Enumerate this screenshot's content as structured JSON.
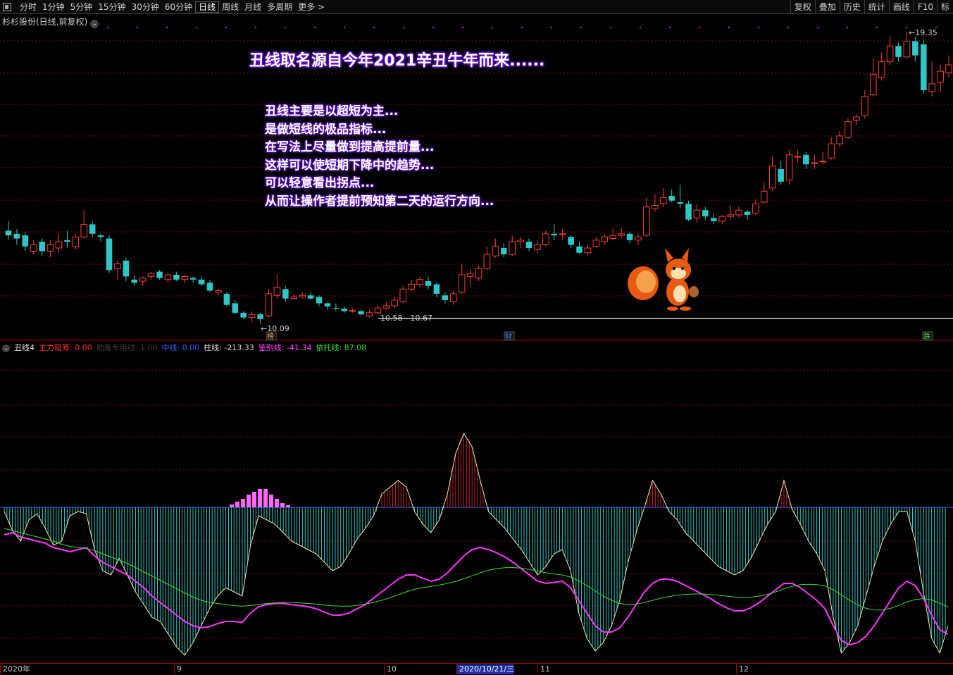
{
  "toolbar": {
    "tabs": [
      "分时",
      "1分钟",
      "5分钟",
      "15分钟",
      "30分钟",
      "60分钟",
      "日线",
      "周线",
      "月线",
      "多周期",
      "更多 >"
    ],
    "active_tab": "日线",
    "right_tools": [
      "复权",
      "叠加",
      "历史",
      "统计",
      "画线",
      "F10",
      "标"
    ]
  },
  "stock": {
    "name": "杉杉股份(日线,前复权)"
  },
  "annotations": {
    "title": "丑线取名源自今年2021辛丑牛年而来......",
    "notes": [
      "丑线主要是以超短为主...",
      "是做短线的极品指标...",
      "在写法上尽量做到提高提前量...",
      "这样可以使短期下降中的趋势...",
      "可以轻意看出拐点...",
      "从而让操作者提前预知第二天的运行方向..."
    ],
    "high_label": "19.35",
    "low_label": "10.09",
    "range_label": "10.58 - 10.67",
    "markers": [
      "榜",
      "财",
      "跌"
    ]
  },
  "indicator": {
    "name": "丑线4",
    "items": [
      {
        "label": "主力吸筹: 0.00",
        "color": "#ff3030"
      },
      {
        "label": "助筹专用线: 1.00",
        "color": "#3a3a3a"
      },
      {
        "label": "中线: 0.00",
        "color": "#3a5cff"
      },
      {
        "label": "柱线: -213.33",
        "color": "#d8d8d8"
      },
      {
        "label": "鉴别线: -41.34",
        "color": "#ff44ff"
      },
      {
        "label": "依托线: 87.08",
        "color": "#33dd33"
      }
    ]
  },
  "dates": [
    {
      "label": "2020年",
      "selected": false
    },
    {
      "label": "9",
      "selected": false
    },
    {
      "label": "10",
      "selected": false
    },
    {
      "label": "2020/10/21/三",
      "selected": true
    },
    {
      "label": "11",
      "selected": false
    },
    {
      "label": "12",
      "selected": false
    }
  ],
  "colors": {
    "up": "#ff3c3c",
    "down": "#2fc6c6",
    "bg": "#000000",
    "grid": "#7a1010"
  },
  "chart_data": [
    {
      "type": "candlestick",
      "title": "杉杉股份(日线,前复权)",
      "price_range": [
        10.09,
        19.35
      ],
      "high": 19.35,
      "low": 10.09,
      "support_range": [
        10.58,
        10.67
      ],
      "candles": [
        [
          13.05,
          12.9,
          13.35,
          12.75
        ],
        [
          12.95,
          12.8,
          13.1,
          12.6
        ],
        [
          12.9,
          12.55,
          13.0,
          12.4
        ],
        [
          12.4,
          12.6,
          12.75,
          12.3
        ],
        [
          12.7,
          12.4,
          12.8,
          12.25
        ],
        [
          12.4,
          12.6,
          12.75,
          12.2
        ],
        [
          12.5,
          12.7,
          12.95,
          12.35
        ],
        [
          12.75,
          12.7,
          13.05,
          12.5
        ],
        [
          12.55,
          12.85,
          12.95,
          12.45
        ],
        [
          12.85,
          13.25,
          13.7,
          12.8
        ],
        [
          13.25,
          12.95,
          13.35,
          12.85
        ],
        [
          12.9,
          12.85,
          12.95,
          12.7
        ],
        [
          12.8,
          11.8,
          12.9,
          11.7
        ],
        [
          11.85,
          12.0,
          12.1,
          11.5
        ],
        [
          12.1,
          11.6,
          12.2,
          11.45
        ],
        [
          11.5,
          11.4,
          11.65,
          11.3
        ],
        [
          11.45,
          11.55,
          11.6,
          11.3
        ],
        [
          11.6,
          11.7,
          11.75,
          11.5
        ],
        [
          11.75,
          11.55,
          11.8,
          11.5
        ],
        [
          11.5,
          11.65,
          11.7,
          11.4
        ],
        [
          11.65,
          11.5,
          11.75,
          11.45
        ],
        [
          11.5,
          11.6,
          11.65,
          11.4
        ],
        [
          11.55,
          11.5,
          11.6,
          11.4
        ],
        [
          11.5,
          11.35,
          11.6,
          11.3
        ],
        [
          11.4,
          11.15,
          11.5,
          11.1
        ],
        [
          11.1,
          11.15,
          11.2,
          11.0
        ],
        [
          11.05,
          10.7,
          11.1,
          10.65
        ],
        [
          10.75,
          10.45,
          10.85,
          10.4
        ],
        [
          10.45,
          10.3,
          10.5,
          10.25
        ],
        [
          10.3,
          10.4,
          10.5,
          10.15
        ],
        [
          10.4,
          10.25,
          10.45,
          10.09
        ],
        [
          10.35,
          11.05,
          11.2,
          10.3
        ],
        [
          11.0,
          11.25,
          11.65,
          10.9
        ],
        [
          11.2,
          10.9,
          11.3,
          10.8
        ],
        [
          10.9,
          10.95,
          11.05,
          10.85
        ],
        [
          10.95,
          11.0,
          11.1,
          10.9
        ],
        [
          11.0,
          10.9,
          11.1,
          10.85
        ],
        [
          10.95,
          10.75,
          11.0,
          10.65
        ],
        [
          10.75,
          10.65,
          10.8,
          10.55
        ],
        [
          10.6,
          10.58,
          10.75,
          10.5
        ],
        [
          10.58,
          10.5,
          10.65,
          10.45
        ],
        [
          10.5,
          10.52,
          10.6,
          10.45
        ],
        [
          10.5,
          10.4,
          10.55,
          10.35
        ],
        [
          10.35,
          10.45,
          10.55,
          10.3
        ],
        [
          10.45,
          10.6,
          10.7,
          10.4
        ],
        [
          10.6,
          10.67,
          10.8,
          10.55
        ],
        [
          10.67,
          10.85,
          10.95,
          10.6
        ],
        [
          10.8,
          11.2,
          11.3,
          10.75
        ],
        [
          11.2,
          11.35,
          11.5,
          11.15
        ],
        [
          11.35,
          11.5,
          11.6,
          11.25
        ],
        [
          11.45,
          11.3,
          11.6,
          11.2
        ],
        [
          11.35,
          11.05,
          11.4,
          10.95
        ],
        [
          11.0,
          10.85,
          11.1,
          10.75
        ],
        [
          10.8,
          11.05,
          11.15,
          10.7
        ],
        [
          11.1,
          11.65,
          12.0,
          11.05
        ],
        [
          11.6,
          11.7,
          11.85,
          11.3
        ],
        [
          11.55,
          11.85,
          11.95,
          11.45
        ],
        [
          11.85,
          12.3,
          12.55,
          11.8
        ],
        [
          12.25,
          12.55,
          12.8,
          12.2
        ],
        [
          12.5,
          12.3,
          12.65,
          12.2
        ],
        [
          12.3,
          12.7,
          12.9,
          12.25
        ],
        [
          12.7,
          12.75,
          12.85,
          12.5
        ],
        [
          12.7,
          12.5,
          12.8,
          12.4
        ],
        [
          12.45,
          12.6,
          12.75,
          12.35
        ],
        [
          12.6,
          12.95,
          13.05,
          12.55
        ],
        [
          12.95,
          12.9,
          13.25,
          12.75
        ],
        [
          12.95,
          12.95,
          13.1,
          12.75
        ],
        [
          12.85,
          12.6,
          12.9,
          12.5
        ],
        [
          12.55,
          12.35,
          12.7,
          12.3
        ],
        [
          12.35,
          12.5,
          12.6,
          12.3
        ],
        [
          12.55,
          12.75,
          12.85,
          12.5
        ],
        [
          12.7,
          12.85,
          12.95,
          12.6
        ],
        [
          12.8,
          12.9,
          13.15,
          12.75
        ],
        [
          12.9,
          12.95,
          13.15,
          12.8
        ],
        [
          12.95,
          12.75,
          13.0,
          12.65
        ],
        [
          12.75,
          12.85,
          12.95,
          12.6
        ],
        [
          12.9,
          13.8,
          14.1,
          12.85
        ],
        [
          13.75,
          13.85,
          14.2,
          13.65
        ],
        [
          13.9,
          14.1,
          14.4,
          13.8
        ],
        [
          14.15,
          14.0,
          14.35,
          13.95
        ],
        [
          13.95,
          13.9,
          14.5,
          13.75
        ],
        [
          13.9,
          13.4,
          14.0,
          13.35
        ],
        [
          13.45,
          13.7,
          13.9,
          13.3
        ],
        [
          13.7,
          13.5,
          13.8,
          13.4
        ],
        [
          13.45,
          13.35,
          13.6,
          13.25
        ],
        [
          13.35,
          13.5,
          13.55,
          13.25
        ],
        [
          13.5,
          13.55,
          13.85,
          13.4
        ],
        [
          13.55,
          13.7,
          13.8,
          13.45
        ],
        [
          13.65,
          13.55,
          13.7,
          13.4
        ],
        [
          13.6,
          13.9,
          14.05,
          13.55
        ],
        [
          13.95,
          14.3,
          14.6,
          13.9
        ],
        [
          14.4,
          15.1,
          15.4,
          14.3
        ],
        [
          15.0,
          14.6,
          15.25,
          14.5
        ],
        [
          14.65,
          15.45,
          15.6,
          14.5
        ],
        [
          15.4,
          15.4,
          15.6,
          15.2
        ],
        [
          15.45,
          15.15,
          15.55,
          15.0
        ],
        [
          15.2,
          15.2,
          15.45,
          15.0
        ],
        [
          15.25,
          15.25,
          15.55,
          15.15
        ],
        [
          15.35,
          15.8,
          16.0,
          15.3
        ],
        [
          15.8,
          16.05,
          16.2,
          15.7
        ],
        [
          16.0,
          16.5,
          16.6,
          15.95
        ],
        [
          16.55,
          16.65,
          16.75,
          16.4
        ],
        [
          16.7,
          17.3,
          17.5,
          16.6
        ],
        [
          17.35,
          18.0,
          18.5,
          17.3
        ],
        [
          17.9,
          18.4,
          18.7,
          17.8
        ],
        [
          18.4,
          18.9,
          19.2,
          18.3
        ],
        [
          18.9,
          18.55,
          19.0,
          18.4
        ],
        [
          18.55,
          19.05,
          19.35,
          18.5
        ],
        [
          19.05,
          18.6,
          19.2,
          18.4
        ],
        [
          18.95,
          17.5,
          19.1,
          17.4
        ],
        [
          17.45,
          17.7,
          18.4,
          17.3
        ],
        [
          17.75,
          18.1,
          18.3,
          17.45
        ],
        [
          18.05,
          18.3,
          18.6,
          17.9
        ]
      ]
    },
    {
      "type": "line",
      "title": "丑线4",
      "series": [
        {
          "name": "柱线",
          "values": [
            -20,
            -110,
            -160,
            -60,
            -30,
            -100,
            -180,
            -160,
            -40,
            -20,
            -30,
            -200,
            -300,
            -320,
            -240,
            -320,
            -400,
            -460,
            -520,
            -540,
            -600,
            -660,
            -700,
            -640,
            -560,
            -480,
            -420,
            -380,
            -400,
            -420,
            -180,
            -40,
            -60,
            -80,
            -120,
            -160,
            -180,
            -200,
            -220,
            -260,
            -300,
            -280,
            -220,
            -150,
            -100,
            -40,
            20,
            30,
            40,
            30,
            -20,
            -80,
            -120,
            -60,
            20,
            80,
            110,
            90,
            40,
            -20,
            -60,
            -100,
            -150,
            -200,
            -260,
            -320,
            -280,
            -220,
            -200,
            -300,
            -500,
            -620,
            -680,
            -640,
            -560,
            -440,
            -260,
            -120,
            0,
            40,
            20,
            -20,
            -60,
            -120,
            -160,
            -200,
            -240,
            -280,
            -300,
            -320,
            -300,
            -240,
            -160,
            -80,
            -20,
            40,
            -10,
            -80,
            -160,
            -220,
            -300,
            -520,
            -690,
            -640,
            -560,
            -420,
            -280,
            -160,
            -80,
            -20,
            -20,
            -160,
            -400,
            -620,
            -690,
            -560
          ]
        },
        {
          "name": "鉴别线",
          "values": [
            -130,
            -120,
            -140,
            -150,
            -160,
            -170,
            -190,
            -200,
            -210,
            -200,
            -190,
            -230,
            -260,
            -280,
            -300,
            -320,
            -350,
            -380,
            -420,
            -450,
            -480,
            -510,
            -540,
            -560,
            -570,
            -565,
            -550,
            -540,
            -540,
            -545,
            -500,
            -470,
            -460,
            -455,
            -455,
            -460,
            -465,
            -470,
            -480,
            -495,
            -510,
            -510,
            -500,
            -480,
            -460,
            -430,
            -400,
            -370,
            -340,
            -320,
            -320,
            -335,
            -350,
            -340,
            -310,
            -270,
            -230,
            -200,
            -190,
            -200,
            -215,
            -235,
            -260,
            -290,
            -320,
            -350,
            -360,
            -355,
            -350,
            -380,
            -440,
            -500,
            -560,
            -590,
            -590,
            -570,
            -520,
            -460,
            -400,
            -360,
            -340,
            -340,
            -350,
            -370,
            -390,
            -410,
            -430,
            -455,
            -475,
            -490,
            -490,
            -475,
            -450,
            -420,
            -390,
            -360,
            -360,
            -380,
            -410,
            -440,
            -480,
            -560,
            -630,
            -650,
            -640,
            -610,
            -560,
            -500,
            -440,
            -380,
            -350,
            -370,
            -430,
            -510,
            -580,
            -600
          ]
        },
        {
          "name": "依托线",
          "values": [
            -100,
            -110,
            -120,
            -130,
            -140,
            -150,
            -160,
            -175,
            -185,
            -190,
            -195,
            -205,
            -220,
            -235,
            -250,
            -265,
            -285,
            -305,
            -325,
            -345,
            -365,
            -385,
            -405,
            -425,
            -440,
            -450,
            -455,
            -460,
            -465,
            -468,
            -465,
            -460,
            -455,
            -452,
            -450,
            -450,
            -452,
            -455,
            -458,
            -462,
            -466,
            -468,
            -468,
            -464,
            -458,
            -450,
            -440,
            -428,
            -414,
            -400,
            -388,
            -380,
            -374,
            -368,
            -360,
            -350,
            -338,
            -324,
            -310,
            -298,
            -290,
            -286,
            -285,
            -288,
            -294,
            -302,
            -310,
            -316,
            -320,
            -330,
            -348,
            -370,
            -395,
            -420,
            -440,
            -455,
            -460,
            -458,
            -450,
            -440,
            -430,
            -422,
            -416,
            -412,
            -410,
            -410,
            -412,
            -416,
            -420,
            -424,
            -426,
            -425,
            -420,
            -412,
            -400,
            -386,
            -374,
            -366,
            -364,
            -366,
            -372,
            -390,
            -414,
            -440,
            -462,
            -478,
            -486,
            -486,
            -478,
            -464,
            -448,
            -436,
            -432,
            -438,
            -454,
            -472
          ]
        }
      ]
    }
  ]
}
